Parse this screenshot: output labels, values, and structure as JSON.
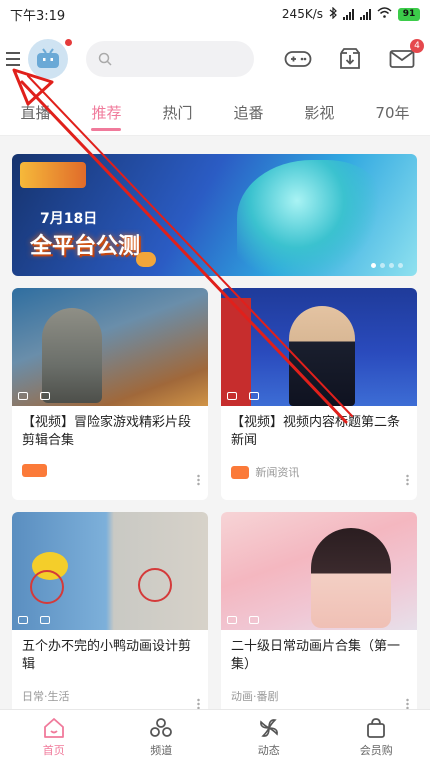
{
  "status_bar": {
    "time": "下午3:19",
    "speed": "245K/s",
    "battery": "91"
  },
  "header": {
    "messages_badge": "4",
    "icons": [
      "menu-icon",
      "avatar",
      "search-icon",
      "game-controller-icon",
      "download-icon",
      "mail-icon"
    ]
  },
  "tabs": [
    {
      "label": "直播"
    },
    {
      "label": "推荐"
    },
    {
      "label": "热门"
    },
    {
      "label": "追番"
    },
    {
      "label": "影视"
    },
    {
      "label": "70年"
    }
  ],
  "banner": {
    "date": "7月18日",
    "headline": "全平台公测"
  },
  "cards": [
    {
      "title": "【视频】冒险家游戏精彩片段剪辑合集",
      "tag": "",
      "meta": ""
    },
    {
      "title": "【视频】视频内容标题第二条新闻",
      "tag": "",
      "meta": "新闻资讯"
    },
    {
      "title": "五个办不完的小鸭动画设计剪辑",
      "tag": "",
      "meta": "日常·生活"
    },
    {
      "title": "二十级日常动画片合集（第一集）",
      "tag": "",
      "meta": "动画·番剧"
    }
  ],
  "bottom_nav": [
    {
      "label": "首页",
      "icon": "home-icon"
    },
    {
      "label": "频道",
      "icon": "channels-icon"
    },
    {
      "label": "动态",
      "icon": "moments-icon"
    },
    {
      "label": "会员购",
      "icon": "shop-bag-icon"
    }
  ],
  "colors": {
    "accent": "#f07a9b",
    "annotation": "#e0201b",
    "tag_orange": "#fb7a39"
  }
}
